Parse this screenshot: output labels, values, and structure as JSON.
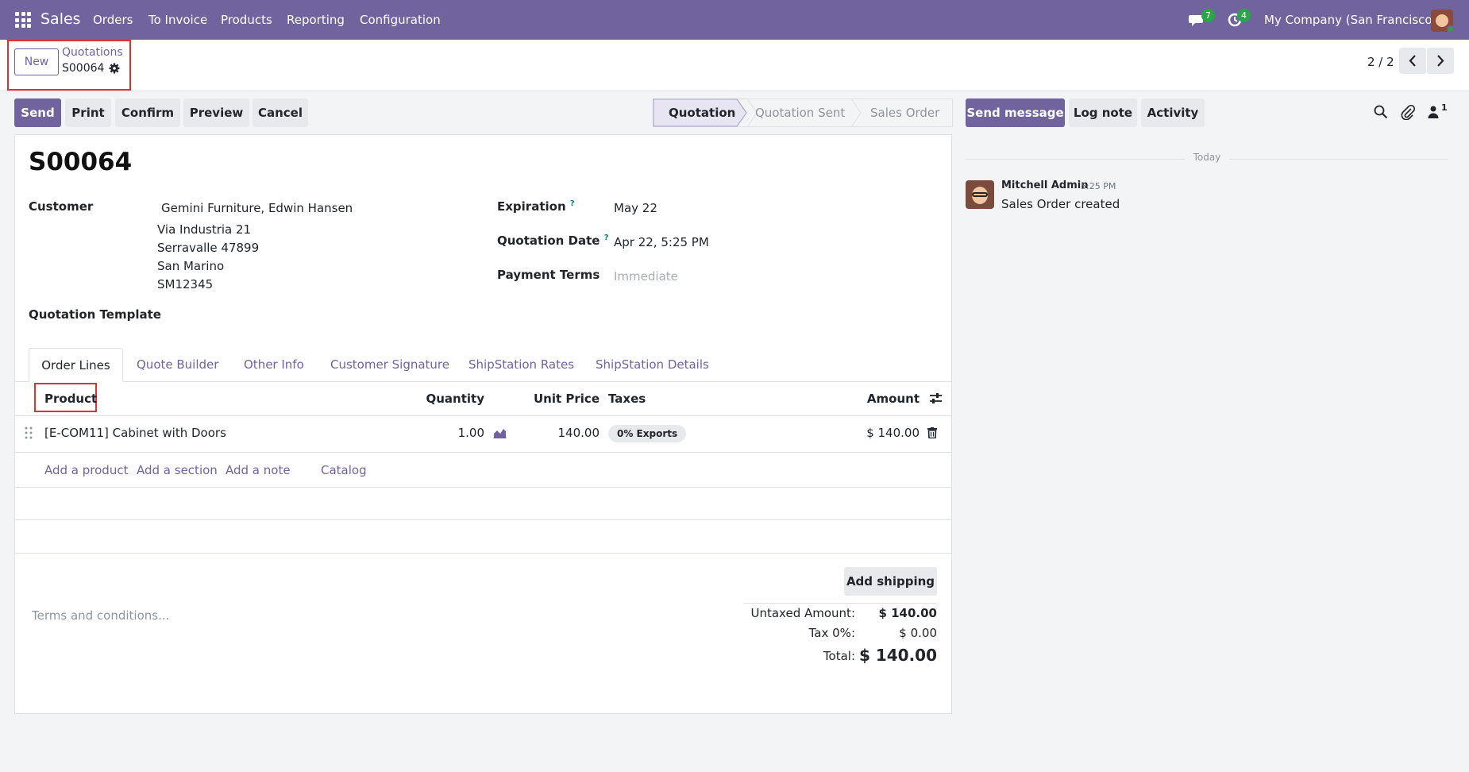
{
  "navbar": {
    "brand": "Sales",
    "menu": [
      "Orders",
      "To Invoice",
      "Products",
      "Reporting",
      "Configuration"
    ],
    "messages_count": "7",
    "activities_count": "4",
    "company": "My Company (San Francisco)"
  },
  "control_panel": {
    "new_label": "New",
    "breadcrumb_parent": "Quotations",
    "breadcrumb_current": "S00064",
    "pager": "2 / 2"
  },
  "actions": {
    "send": "Send",
    "print": "Print",
    "confirm": "Confirm",
    "preview": "Preview",
    "cancel": "Cancel"
  },
  "statusbar": {
    "stages": [
      "Quotation",
      "Quotation Sent",
      "Sales Order"
    ],
    "active": "Quotation"
  },
  "record": {
    "name": "S00064",
    "customer_label": "Customer",
    "customer_name": "Gemini Furniture, Edwin Hansen",
    "address": [
      "Via Industria 21",
      "Serravalle 47899",
      "San Marino",
      "SM12345"
    ],
    "expiration_label": "Expiration",
    "expiration": "May 22",
    "quotation_date_label": "Quotation Date",
    "quotation_date": "Apr 22, 5:25 PM",
    "payment_terms_label": "Payment Terms",
    "payment_terms_placeholder": "Immediate",
    "template_label": "Quotation Template"
  },
  "tabs": [
    "Order Lines",
    "Quote Builder",
    "Other Info",
    "Customer Signature",
    "ShipStation Rates",
    "ShipStation Details"
  ],
  "table": {
    "headers": {
      "product": "Product",
      "quantity": "Quantity",
      "unit_price": "Unit Price",
      "taxes": "Taxes",
      "amount": "Amount"
    },
    "rows": [
      {
        "product": "[E-COM11] Cabinet with Doors",
        "quantity": "1.00",
        "unit_price": "140.00",
        "taxes": "0% Exports",
        "amount": "$ 140.00"
      }
    ],
    "add_links": [
      "Add a product",
      "Add a section",
      "Add a note",
      "Catalog"
    ]
  },
  "footer": {
    "terms_placeholder": "Terms and conditions...",
    "add_shipping": "Add shipping",
    "untaxed_label": "Untaxed Amount:",
    "untaxed_value": "$ 140.00",
    "tax_label": "Tax 0%:",
    "tax_value": "$ 0.00",
    "total_label": "Total:",
    "total_value": "$ 140.00"
  },
  "chatter": {
    "send_message": "Send message",
    "log_note": "Log note",
    "activity": "Activity",
    "followers_count": "1",
    "date_separator": "Today",
    "messages": [
      {
        "author": "Mitchell Admin",
        "time": "5:25 PM",
        "body": "Sales Order created"
      }
    ]
  },
  "colors": {
    "brand": "#71639e",
    "badge": "#28a745",
    "highlight": "#e03131"
  }
}
